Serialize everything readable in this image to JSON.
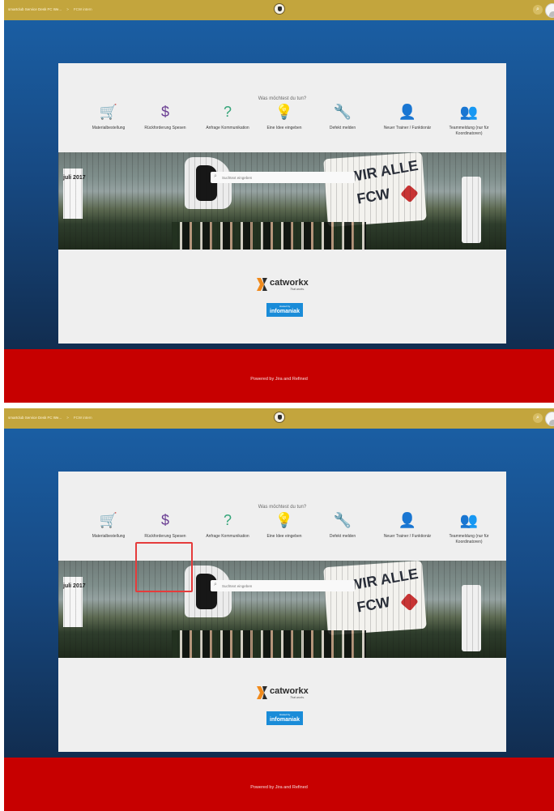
{
  "topbar": {
    "breadcrumb": [
      "smartclub Service Desk FC We...",
      "FCW intern"
    ],
    "breadcrumb_separator": ">",
    "search_icon": "search-icon",
    "avatar": "user-avatar"
  },
  "main": {
    "question": "Was möchtest du tun?",
    "services": [
      {
        "label": "Materialbestellung",
        "icon": "cart-icon",
        "glyph": "🛒"
      },
      {
        "label": "Rückforderung Spesen",
        "icon": "dollar-icon",
        "glyph": "$"
      },
      {
        "label": "Anfrage Kommunikation",
        "icon": "question-bubble-icon",
        "glyph": "?"
      },
      {
        "label": "Eine Idee eingeben",
        "icon": "lightbulb-icon",
        "glyph": "💡"
      },
      {
        "label": "Defekt melden",
        "icon": "wrench-icon",
        "glyph": "🔧"
      },
      {
        "label": "Neuer Trainer / Funktionär",
        "icon": "user-plus-icon",
        "glyph": "👤"
      },
      {
        "label": "Teammeldung (nur für Koordinatoren)",
        "icon": "team-icon",
        "glyph": "👥"
      }
    ],
    "hero": {
      "search_placeholder": "Suchtext eingeben",
      "banner_line1": "WIR ALLE",
      "banner_line2": "FCW",
      "poster_text": "juli 2017"
    },
    "sponsors": {
      "catworkx_name": "catworkx",
      "catworkx_tagline": "That works.",
      "infomaniak_small": "Hosted by",
      "infomaniak_name": "infomaniak"
    }
  },
  "footer": {
    "powered_by": "Powered by Jira and Refined"
  },
  "annotation": {
    "highlighted_service": "Rückforderung Spesen"
  },
  "colors": {
    "topbar": "#c3a53d",
    "background_blue_top": "#1a5ea3",
    "background_blue_bottom": "#112d50",
    "footer_red": "#c70000",
    "highlight_box": "#e53b3b"
  }
}
